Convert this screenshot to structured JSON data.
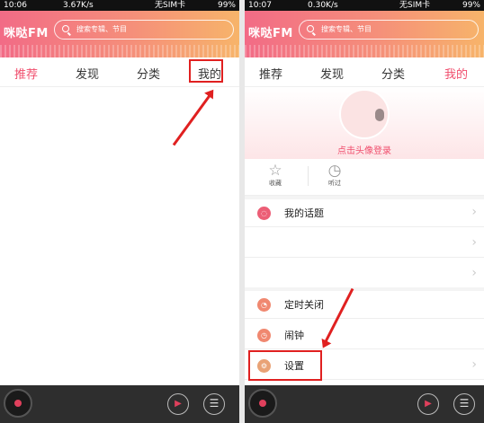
{
  "left": {
    "status": {
      "time": "10:06",
      "speed": "3.67K/s",
      "sim": "无SIM卡",
      "battery": "99%"
    },
    "logo": "咪哒FM",
    "search_placeholder": "搜索专辑、节目",
    "tabs": [
      "推荐",
      "发现",
      "分类",
      "我的"
    ]
  },
  "right": {
    "status": {
      "time": "10:07",
      "speed": "0.30K/s",
      "sim": "无SIM卡",
      "battery": "99%"
    },
    "logo": "咪哒FM",
    "search_placeholder": "搜索专辑、节目",
    "tabs": [
      "推荐",
      "发现",
      "分类",
      "我的"
    ],
    "login_text": "点击头像登录",
    "quick": [
      {
        "icon": "star-icon",
        "label": "收藏"
      },
      {
        "icon": "history-icon",
        "label": "听过"
      }
    ],
    "menu": [
      {
        "icon": "chat-bubble-icon",
        "label": "我的话题"
      },
      {
        "icon": "",
        "label": ""
      },
      {
        "icon": "",
        "label": ""
      },
      {
        "icon": "timer-icon",
        "label": "定时关闭"
      },
      {
        "icon": "alarm-clock-icon",
        "label": "闹钟"
      },
      {
        "icon": "gear-icon",
        "label": "设置"
      }
    ]
  },
  "colors": {
    "accent": "#f04e6d",
    "annotation": "#e02020"
  },
  "player": {
    "play_glyph": "▶",
    "list_glyph": "☰"
  }
}
